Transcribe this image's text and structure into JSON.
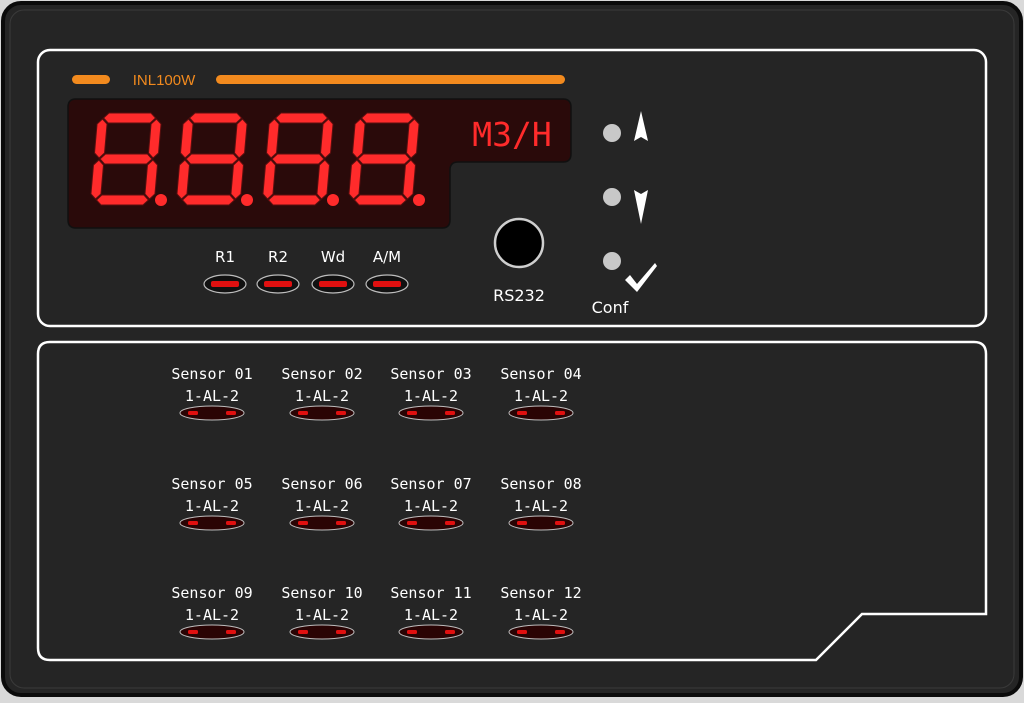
{
  "device": {
    "model_label": "INL100W",
    "display": {
      "digits": [
        "8.",
        "8.",
        "8.",
        "8."
      ],
      "unit": "M3/H"
    },
    "status_leds": [
      {
        "label": "R1"
      },
      {
        "label": "R2"
      },
      {
        "label": "Wd"
      },
      {
        "label": "A/M"
      }
    ],
    "rs232_label": "RS232",
    "buttons": {
      "up_icon": "arrow-up-icon",
      "down_icon": "arrow-down-icon",
      "confirm_icon": "checkmark-icon",
      "confirm_label": "Conf"
    },
    "sensors": [
      {
        "name": "Sensor 01",
        "alarm_label": "1-AL-2"
      },
      {
        "name": "Sensor 02",
        "alarm_label": "1-AL-2"
      },
      {
        "name": "Sensor 03",
        "alarm_label": "1-AL-2"
      },
      {
        "name": "Sensor 04",
        "alarm_label": "1-AL-2"
      },
      {
        "name": "Sensor 05",
        "alarm_label": "1-AL-2"
      },
      {
        "name": "Sensor 06",
        "alarm_label": "1-AL-2"
      },
      {
        "name": "Sensor 07",
        "alarm_label": "1-AL-2"
      },
      {
        "name": "Sensor 08",
        "alarm_label": "1-AL-2"
      },
      {
        "name": "Sensor 09",
        "alarm_label": "1-AL-2"
      },
      {
        "name": "Sensor 10",
        "alarm_label": "1-AL-2"
      },
      {
        "name": "Sensor 11",
        "alarm_label": "1-AL-2"
      },
      {
        "name": "Sensor 12",
        "alarm_label": "1-AL-2"
      }
    ]
  },
  "colors": {
    "panel": "#242424",
    "accent_orange": "#f28a1e",
    "segment_red": "#ff2b2b",
    "display_bg": "#2a0a0a",
    "led_red": "#e01010"
  }
}
